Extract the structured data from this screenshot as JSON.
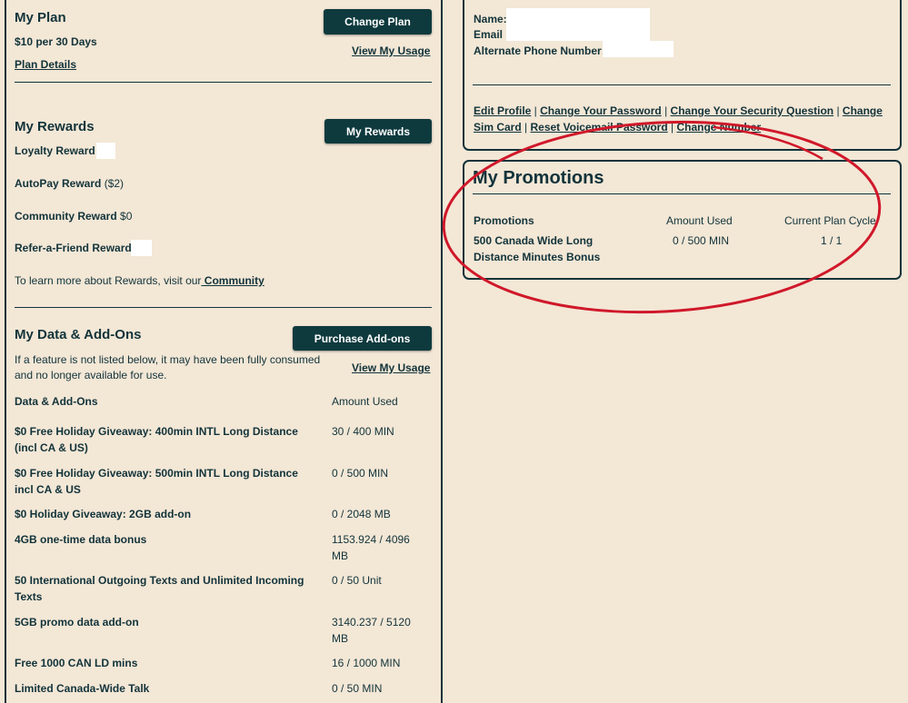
{
  "plan": {
    "title": "My Plan",
    "change_btn": "Change Plan",
    "price": "$10 per 30 Days",
    "usage_link": "View My Usage",
    "details_link": "Plan Details"
  },
  "rewards": {
    "title": "My Rewards",
    "btn": "My Rewards",
    "loyalty": "Loyalty Reward",
    "loyalty_paren": "(",
    "autopay": "AutoPay Reward",
    "autopay_val": "($2)",
    "community": "Community Reward",
    "community_val": "$0",
    "refer": "Refer-a-Friend Reward",
    "learn_text": "To learn more about Rewards, visit our",
    "community_link": " Community"
  },
  "addons": {
    "title": "My Data & Add-Ons",
    "btn": "Purchase Add-ons",
    "note": "If a feature is not listed below, it may have been fully consumed and no longer available for use.",
    "usage_link": "View My Usage",
    "col_name": "Data & Add-Ons",
    "col_amount": "Amount Used",
    "rows": [
      {
        "name": "$0 Free Holiday Giveaway: 400min INTL Long Distance (incl CA & US)",
        "amount": "30  /  400 MIN"
      },
      {
        "name": "$0 Free Holiday Giveaway: 500min INTL Long Distance incl CA & US",
        "amount": "0  /  500 MIN"
      },
      {
        "name": "$0 Holiday Giveaway: 2GB add-on",
        "amount": "0  /  2048 MB"
      },
      {
        "name": "4GB one-time data bonus",
        "amount": "1153.924  /  4096 MB"
      },
      {
        "name": "50 International Outgoing Texts and Unlimited Incoming Texts",
        "amount": "0  /  50 Unit"
      },
      {
        "name": "5GB promo data add-on",
        "amount": "3140.237  /  5120 MB"
      },
      {
        "name": "Free 1000 CAN LD mins",
        "amount": "16  /  1000 MIN"
      },
      {
        "name": "Limited Canada-Wide Talk",
        "amount": "0  /  50 MIN"
      }
    ]
  },
  "profile": {
    "name_label": "Name:",
    "email_label": "Email :",
    "alt_phone_label": "Alternate Phone Number:",
    "links": [
      "Edit Profile",
      "Change Your Password",
      "Change Your Security Question",
      "Change Sim Card",
      "Reset Voicemail Password",
      "Change Number"
    ],
    "sep": " | "
  },
  "promotions": {
    "title": "My Promotions",
    "col_name": "Promotions",
    "col_amount": "Amount Used",
    "col_cycle": "Current Plan Cycle",
    "rows": [
      {
        "name": "500 Canada Wide Long Distance Minutes Bonus",
        "amount": "0 / 500 MIN",
        "cycle": "1 / 1"
      }
    ]
  },
  "colors": {
    "accent": "#0e3a3e",
    "background": "#f3e7d6",
    "annotation": "#d0182a"
  }
}
